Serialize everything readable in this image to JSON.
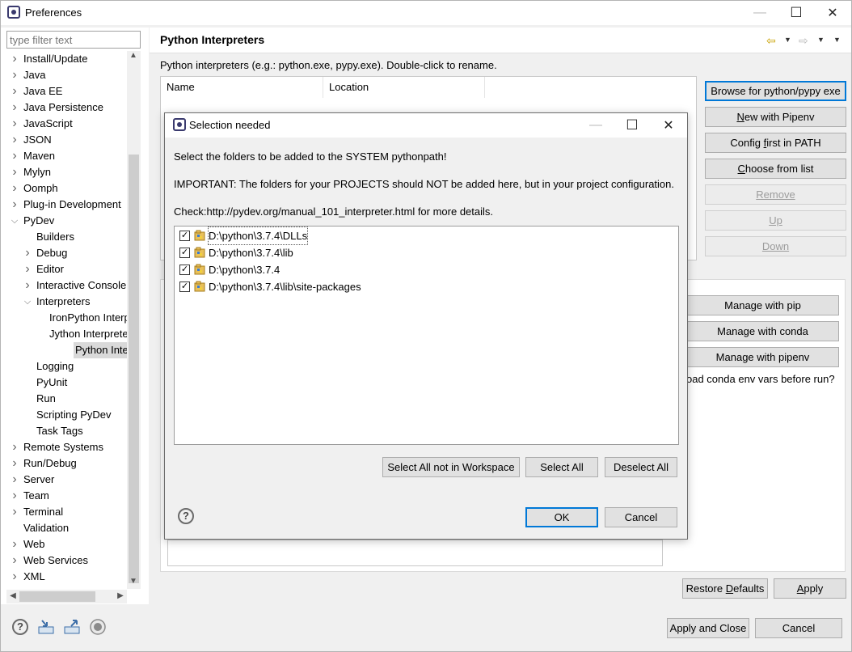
{
  "window": {
    "title": "Preferences"
  },
  "filter": {
    "placeholder": "type filter text"
  },
  "tree": [
    {
      "label": "Install/Update",
      "level": 0,
      "arrow": "right"
    },
    {
      "label": "Java",
      "level": 0,
      "arrow": "right"
    },
    {
      "label": "Java EE",
      "level": 0,
      "arrow": "right"
    },
    {
      "label": "Java Persistence",
      "level": 0,
      "arrow": "right"
    },
    {
      "label": "JavaScript",
      "level": 0,
      "arrow": "right"
    },
    {
      "label": "JSON",
      "level": 0,
      "arrow": "right"
    },
    {
      "label": "Maven",
      "level": 0,
      "arrow": "right"
    },
    {
      "label": "Mylyn",
      "level": 0,
      "arrow": "right"
    },
    {
      "label": "Oomph",
      "level": 0,
      "arrow": "right"
    },
    {
      "label": "Plug-in Development",
      "level": 0,
      "arrow": "right"
    },
    {
      "label": "PyDev",
      "level": 0,
      "arrow": "down"
    },
    {
      "label": "Builders",
      "level": 1,
      "arrow": "none"
    },
    {
      "label": "Debug",
      "level": 1,
      "arrow": "right"
    },
    {
      "label": "Editor",
      "level": 1,
      "arrow": "right"
    },
    {
      "label": "Interactive Console",
      "level": 1,
      "arrow": "right"
    },
    {
      "label": "Interpreters",
      "level": 1,
      "arrow": "down"
    },
    {
      "label": "IronPython Interpreter",
      "level": 2,
      "arrow": "none"
    },
    {
      "label": "Jython Interpreter",
      "level": 2,
      "arrow": "none"
    },
    {
      "label": "Python Interpreter",
      "level": 2,
      "arrow": "none",
      "selected": true
    },
    {
      "label": "Logging",
      "level": 1,
      "arrow": "none"
    },
    {
      "label": "PyUnit",
      "level": 1,
      "arrow": "none"
    },
    {
      "label": "Run",
      "level": 1,
      "arrow": "none"
    },
    {
      "label": "Scripting PyDev",
      "level": 1,
      "arrow": "none"
    },
    {
      "label": "Task Tags",
      "level": 1,
      "arrow": "none"
    },
    {
      "label": "Remote Systems",
      "level": 0,
      "arrow": "right"
    },
    {
      "label": "Run/Debug",
      "level": 0,
      "arrow": "right"
    },
    {
      "label": "Server",
      "level": 0,
      "arrow": "right"
    },
    {
      "label": "Team",
      "level": 0,
      "arrow": "right"
    },
    {
      "label": "Terminal",
      "level": 0,
      "arrow": "right"
    },
    {
      "label": "Validation",
      "level": 0,
      "arrow": "none"
    },
    {
      "label": "Web",
      "level": 0,
      "arrow": "right"
    },
    {
      "label": "Web Services",
      "level": 0,
      "arrow": "right"
    },
    {
      "label": "XML",
      "level": 0,
      "arrow": "right"
    }
  ],
  "panel": {
    "title": "Python Interpreters",
    "description": "Python interpreters (e.g.: python.exe, pypy.exe).   Double-click to rename.",
    "table_headers": [
      "Name",
      "Location"
    ],
    "side_buttons": {
      "browse": "Browse for python/pypy exe",
      "pipenv_pre": "",
      "pipenv_u": "N",
      "pipenv_post": "ew with Pipenv",
      "config_pre": "Config ",
      "config_u": "f",
      "config_post": "irst in PATH",
      "choose_pre": "",
      "choose_u": "C",
      "choose_post": "hoose from list",
      "remove": "Remove",
      "up": "Up",
      "down": "Down"
    },
    "manage": {
      "pip": "Manage with pip",
      "conda": "Manage with conda",
      "pipenv": "Manage with pipenv",
      "conda_env": "oad conda env vars before run?"
    },
    "restore_pre": "Restore ",
    "restore_u": "D",
    "restore_post": "efaults",
    "apply_pre": "",
    "apply_u": "A",
    "apply_post": "pply"
  },
  "footer": {
    "apply_close": "Apply and Close",
    "cancel": "Cancel"
  },
  "dialog": {
    "title": "Selection needed",
    "line1": "Select the folders to be added to the SYSTEM pythonpath!",
    "line2": "IMPORTANT: The folders for your PROJECTS should NOT be added here, but in your project configuration.",
    "line3": "Check:http://pydev.org/manual_101_interpreter.html for more details.",
    "items": [
      {
        "path": "D:\\python\\3.7.4\\DLLs",
        "checked": "✓"
      },
      {
        "path": "D:\\python\\3.7.4\\lib",
        "checked": "✓"
      },
      {
        "path": "D:\\python\\3.7.4",
        "checked": "✓"
      },
      {
        "path": "D:\\python\\3.7.4\\lib\\site-packages",
        "checked": "✓"
      }
    ],
    "select_not_ws": "Select All not in Workspace",
    "select_all": "Select All",
    "deselect_all": "Deselect All",
    "ok": "OK",
    "cancel": "Cancel",
    "help": "?"
  },
  "icons": {
    "help": "?",
    "minimize": "—",
    "maximize": "☐",
    "close": "✕"
  }
}
